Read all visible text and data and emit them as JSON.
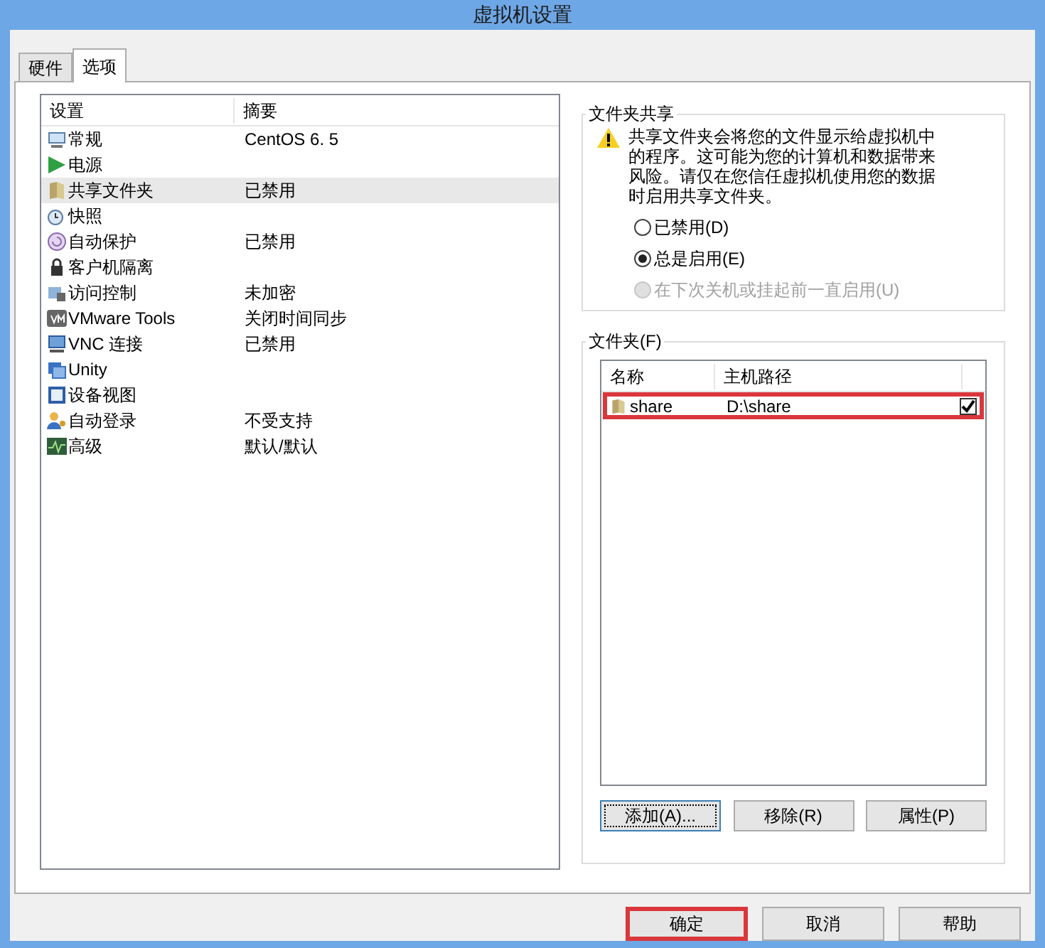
{
  "window": {
    "title": "虚拟机设置"
  },
  "tabs": [
    {
      "label": "硬件",
      "selected": false
    },
    {
      "label": "选项",
      "selected": true
    }
  ],
  "settings": {
    "columns": [
      "设置",
      "摘要"
    ],
    "rows": [
      {
        "name": "常规",
        "summary": "CentOS 6. 5",
        "selected": false
      },
      {
        "name": "电源",
        "summary": "",
        "selected": false
      },
      {
        "name": "共享文件夹",
        "summary": "已禁用",
        "selected": true
      },
      {
        "name": "快照",
        "summary": "",
        "selected": false
      },
      {
        "name": "自动保护",
        "summary": "已禁用",
        "selected": false
      },
      {
        "name": "客户机隔离",
        "summary": "",
        "selected": false
      },
      {
        "name": "访问控制",
        "summary": "未加密",
        "selected": false
      },
      {
        "name": "VMware Tools",
        "summary": "关闭时间同步",
        "selected": false
      },
      {
        "name": "VNC 连接",
        "summary": "已禁用",
        "selected": false
      },
      {
        "name": "Unity",
        "summary": "",
        "selected": false
      },
      {
        "name": "设备视图",
        "summary": "",
        "selected": false
      },
      {
        "name": "自动登录",
        "summary": "不受支持",
        "selected": false
      },
      {
        "name": "高级",
        "summary": "默认/默认",
        "selected": false
      }
    ]
  },
  "sharing": {
    "title": "文件夹共享",
    "warning": "共享文件夹会将您的文件显示给虚拟机中的程序。这可能为您的计算机和数据带来风险。请仅在您信任虚拟机使用您的数据时启用共享文件夹。",
    "options": [
      {
        "label": "已禁用(D)",
        "selected": false,
        "disabled": false
      },
      {
        "label": "总是启用(E)",
        "selected": true,
        "disabled": false
      },
      {
        "label": "在下次关机或挂起前一直启用(U)",
        "selected": false,
        "disabled": true
      }
    ]
  },
  "folders": {
    "title": "文件夹(F)",
    "columns": [
      "名称",
      "主机路径"
    ],
    "rows": [
      {
        "name": "share",
        "path": "D:\\share",
        "checked": true,
        "highlighted": true
      }
    ],
    "buttons": [
      "添加(A)...",
      "移除(R)",
      "属性(P)"
    ]
  },
  "footer_buttons": [
    {
      "label": "确定",
      "highlighted": true
    },
    {
      "label": "取消",
      "highlighted": false
    },
    {
      "label": "帮助",
      "highlighted": false
    }
  ]
}
